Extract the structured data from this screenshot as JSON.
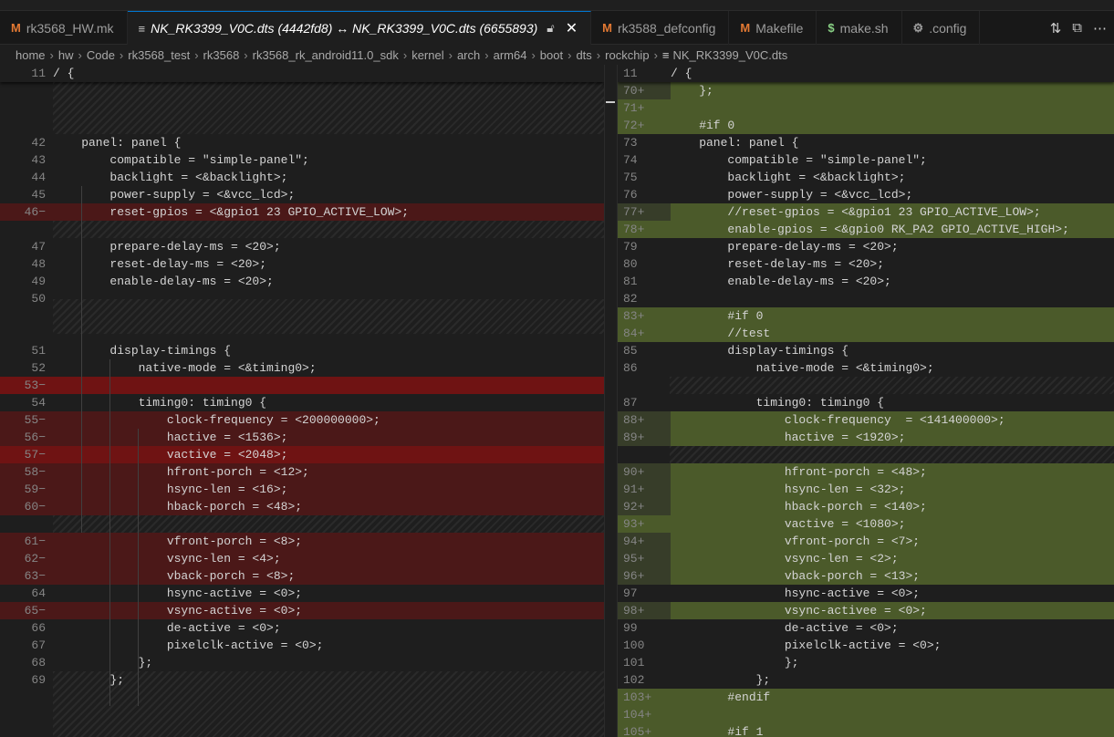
{
  "tabs": [
    {
      "icon": "M",
      "icon_name": "makefile-icon",
      "label": "rk3568_HW.mk"
    },
    {
      "icon": "≡",
      "icon_name": "diff-file-icon",
      "label": "NK_RK3399_V0C.dts (4442fd8) ↔ NK_RK3399_V0C.dts (6655893)",
      "active": true
    },
    {
      "icon": "M",
      "icon_name": "makefile-icon",
      "label": "rk3588_defconfig"
    },
    {
      "icon": "M",
      "icon_name": "makefile-icon",
      "label": "Makefile"
    },
    {
      "icon": "$",
      "icon_name": "shell-icon",
      "label": "make.sh"
    },
    {
      "icon": "⚙",
      "icon_name": "gear-icon",
      "label": ".config"
    }
  ],
  "breadcrumb": [
    "home",
    "hw",
    "Code",
    "rk3568_test",
    "rk3568",
    "rk3568_rk_android11.0_sdk",
    "kernel",
    "arch",
    "arm64",
    "boot",
    "dts",
    "rockchip",
    "NK_RK3399_V0C.dts"
  ],
  "left": {
    "sticky": {
      "ln": "11",
      "code": "/ {"
    },
    "rows": [
      {
        "ln": "42",
        "code": "    panel: panel {",
        "type": "ctx"
      },
      {
        "ln": "43",
        "code": "        compatible = \"simple-panel\";",
        "type": "ctx"
      },
      {
        "ln": "44",
        "code": "        backlight = <&backlight>;",
        "type": "ctx"
      },
      {
        "ln": "45",
        "code": "        power-supply = <&vcc_lcd>;",
        "type": "ctx"
      },
      {
        "ln": "46−",
        "code": "        reset-gpios = <&gpio1 23 GPIO_ACTIVE_LOW>;",
        "type": "del"
      },
      {
        "ln": "47",
        "code": "        prepare-delay-ms = <20>;",
        "type": "ctx"
      },
      {
        "ln": "48",
        "code": "        reset-delay-ms = <20>;",
        "type": "ctx"
      },
      {
        "ln": "49",
        "code": "        enable-delay-ms = <20>;",
        "type": "ctx"
      },
      {
        "ln": "50",
        "code": "",
        "type": "ctx"
      },
      {
        "ln": "51",
        "code": "        display-timings {",
        "type": "ctx"
      },
      {
        "ln": "52",
        "code": "            native-mode = <&timing0>;",
        "type": "ctx"
      },
      {
        "ln": "53−",
        "code": "",
        "type": "fulldel"
      },
      {
        "ln": "54",
        "code": "            timing0: timing0 {",
        "type": "ctx"
      },
      {
        "ln": "55−",
        "code": "                clock-frequency = <200000000>;",
        "type": "del"
      },
      {
        "ln": "56−",
        "code": "                hactive = <1536>;",
        "type": "del"
      },
      {
        "ln": "57−",
        "code": "                vactive = <2048>;",
        "type": "fulldel"
      },
      {
        "ln": "58−",
        "code": "                hfront-porch = <12>;",
        "type": "del"
      },
      {
        "ln": "59−",
        "code": "                hsync-len = <16>;",
        "type": "del"
      },
      {
        "ln": "60−",
        "code": "                hback-porch = <48>;",
        "type": "del"
      },
      {
        "ln": "61−",
        "code": "                vfront-porch = <8>;",
        "type": "del"
      },
      {
        "ln": "62−",
        "code": "                vsync-len = <4>;",
        "type": "del"
      },
      {
        "ln": "63−",
        "code": "                vback-porch = <8>;",
        "type": "del"
      },
      {
        "ln": "64",
        "code": "                hsync-active = <0>;",
        "type": "ctx"
      },
      {
        "ln": "65−",
        "code": "                vsync-active = <0>;",
        "type": "del"
      },
      {
        "ln": "66",
        "code": "                de-active = <0>;",
        "type": "ctx"
      },
      {
        "ln": "67",
        "code": "                pixelclk-active = <0>;",
        "type": "ctx"
      },
      {
        "ln": "68",
        "code": "            };",
        "type": "ctx"
      },
      {
        "ln": "69",
        "code": "        };",
        "type": "ctx"
      }
    ]
  },
  "right": {
    "sticky": {
      "ln": "11",
      "code": "/ {"
    },
    "rows": [
      {
        "ln": "70+",
        "code": "    };",
        "type": "ins"
      },
      {
        "ln": "71+",
        "code": "",
        "type": "fullins"
      },
      {
        "ln": "72+",
        "code": "    #if 0",
        "type": "fullins"
      },
      {
        "ln": "73",
        "code": "    panel: panel {",
        "type": "ctx"
      },
      {
        "ln": "74",
        "code": "        compatible = \"simple-panel\";",
        "type": "ctx"
      },
      {
        "ln": "75",
        "code": "        backlight = <&backlight>;",
        "type": "ctx"
      },
      {
        "ln": "76",
        "code": "        power-supply = <&vcc_lcd>;",
        "type": "ctx"
      },
      {
        "ln": "77+",
        "code": "        //reset-gpios = <&gpio1 23 GPIO_ACTIVE_LOW>;",
        "type": "ins"
      },
      {
        "ln": "78+",
        "code": "        enable-gpios = <&gpio0 RK_PA2 GPIO_ACTIVE_HIGH>;",
        "type": "fullins"
      },
      {
        "ln": "79",
        "code": "        prepare-delay-ms = <20>;",
        "type": "ctx"
      },
      {
        "ln": "80",
        "code": "        reset-delay-ms = <20>;",
        "type": "ctx"
      },
      {
        "ln": "81",
        "code": "        enable-delay-ms = <20>;",
        "type": "ctx"
      },
      {
        "ln": "82",
        "code": "",
        "type": "ctx"
      },
      {
        "ln": "83+",
        "code": "        #if 0",
        "type": "fullins"
      },
      {
        "ln": "84+",
        "code": "        //test",
        "type": "fullins"
      },
      {
        "ln": "85",
        "code": "        display-timings {",
        "type": "ctx"
      },
      {
        "ln": "86",
        "code": "            native-mode = <&timing0>;",
        "type": "ctx"
      },
      {
        "ln": "87",
        "code": "            timing0: timing0 {",
        "type": "ctx"
      },
      {
        "ln": "88+",
        "code": "                clock-frequency  = <141400000>;",
        "type": "ins"
      },
      {
        "ln": "89+",
        "code": "                hactive = <1920>;",
        "type": "ins"
      },
      {
        "ln": "90+",
        "code": "                hfront-porch = <48>;",
        "type": "ins"
      },
      {
        "ln": "91+",
        "code": "                hsync-len = <32>;",
        "type": "ins"
      },
      {
        "ln": "92+",
        "code": "                hback-porch = <140>;",
        "type": "ins"
      },
      {
        "ln": "93+",
        "code": "                vactive = <1080>;",
        "type": "fullins"
      },
      {
        "ln": "94+",
        "code": "                vfront-porch = <7>;",
        "type": "ins"
      },
      {
        "ln": "95+",
        "code": "                vsync-len = <2>;",
        "type": "ins"
      },
      {
        "ln": "96+",
        "code": "                vback-porch = <13>;",
        "type": "ins"
      },
      {
        "ln": "97",
        "code": "                hsync-active = <0>;",
        "type": "ctx"
      },
      {
        "ln": "98+",
        "code": "                vsync-activee = <0>;",
        "type": "ins"
      },
      {
        "ln": "99",
        "code": "                de-active = <0>;",
        "type": "ctx"
      },
      {
        "ln": "100",
        "code": "                pixelclk-active = <0>;",
        "type": "ctx"
      },
      {
        "ln": "101",
        "code": "                };",
        "type": "ctx"
      },
      {
        "ln": "102",
        "code": "            };",
        "type": "ctx"
      },
      {
        "ln": "103+",
        "code": "        #endif",
        "type": "fullins"
      },
      {
        "ln": "104+",
        "code": "",
        "type": "fullins"
      },
      {
        "ln": "105+",
        "code": "        #if 1",
        "type": "fullins"
      }
    ]
  },
  "colors": {
    "deleted_line": "#4b1818",
    "deleted_char": "#6f1313",
    "inserted_line": "#373d29",
    "inserted_char": "#4b5a2a",
    "active_tab_border": "#0078d4"
  }
}
